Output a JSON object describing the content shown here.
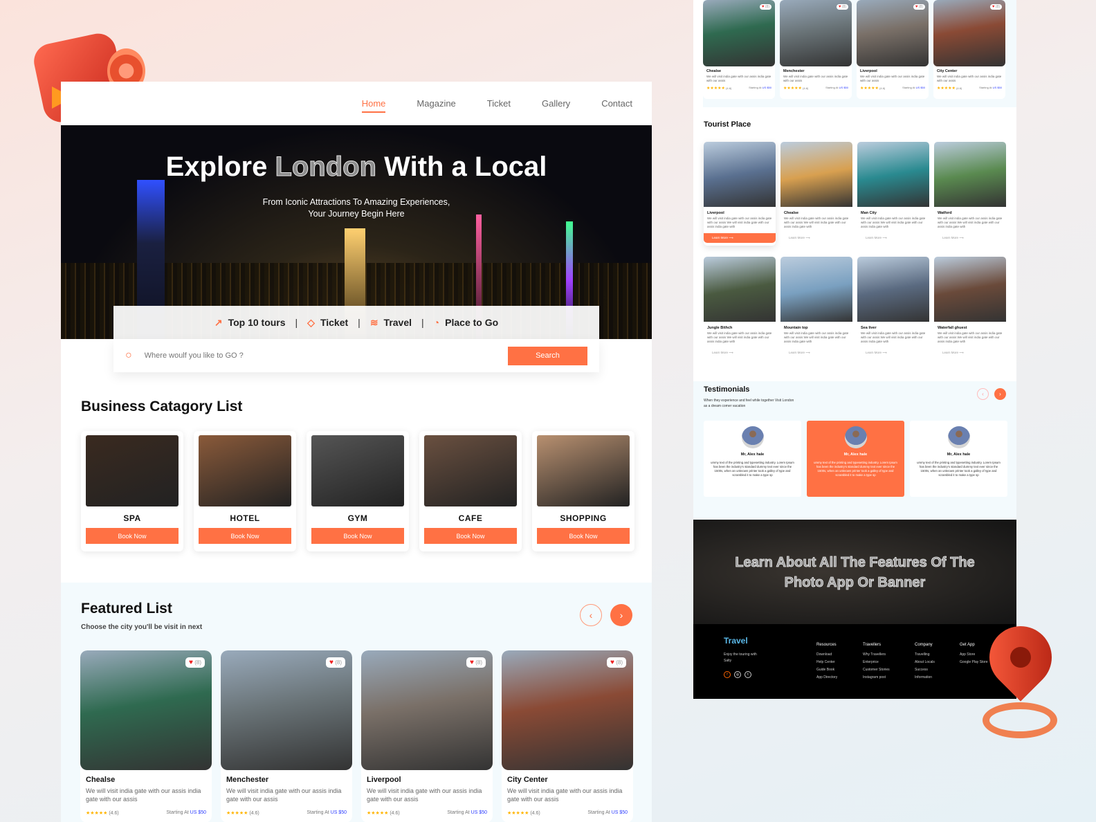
{
  "nav": {
    "items": [
      "Home",
      "Magazine",
      "Ticket",
      "Gallery",
      "Contact"
    ],
    "active": 0
  },
  "hero": {
    "title_pre": "Explore",
    "title_mid": "London",
    "title_post": "With a Local",
    "subtitle_1": "From Iconic Attractions To Amazing Experiences,",
    "subtitle_2": "Your Journey Begin Here"
  },
  "tabs": [
    {
      "icon": "trending-up-icon",
      "glyph": "↗",
      "label": "Top 10 tours"
    },
    {
      "icon": "ticket-icon",
      "glyph": "◇",
      "label": "Ticket"
    },
    {
      "icon": "travel-icon",
      "glyph": "≋",
      "label": "Travel"
    },
    {
      "icon": "location-icon",
      "glyph": "◔",
      "label": "Place to Go"
    }
  ],
  "search": {
    "placeholder": "Where woulf you like to GO ?",
    "button": "Search"
  },
  "business": {
    "title": "Business Catagory List",
    "button": "Book Now",
    "items": [
      {
        "name": "SPA",
        "color": "#3a2a20"
      },
      {
        "name": "HOTEL",
        "color": "#8a5a3a"
      },
      {
        "name": "GYM",
        "color": "#555"
      },
      {
        "name": "CAFE",
        "color": "#6a5040"
      },
      {
        "name": "SHOPPING",
        "color": "#b89070"
      }
    ]
  },
  "featured": {
    "title": "Featured List",
    "subtitle": "Choose the city you'll be visit in next",
    "items": [
      {
        "title": "Chealse",
        "desc": "We will visit india gate with our assis india gate with our assis",
        "likes": "(8)",
        "rating": "(4.6)",
        "price_label": "Starting At",
        "price": "US $50",
        "color": "#2f6a50"
      },
      {
        "title": "Menchester",
        "desc": "We will visit india gate with our assis india gate with our assis",
        "likes": "(8)",
        "rating": "(4.6)",
        "price_label": "Starting At",
        "price": "US $50",
        "color": "#6a7478"
      },
      {
        "title": "Liverpool",
        "desc": "We will visit india gate with our assis india gate with our assis",
        "likes": "(8)",
        "rating": "(4.6)",
        "price_label": "Starting At",
        "price": "US $50",
        "color": "#7a7068"
      },
      {
        "title": "City Center",
        "desc": "We will visit india gate with our assis india gate with our assis",
        "likes": "(8)",
        "rating": "(4.6)",
        "price_label": "Starting At",
        "price": "US $50",
        "color": "#8a4a35"
      }
    ]
  },
  "tourist": {
    "title": "Tourist Place",
    "learn_more": "Learn More",
    "desc": "We will visit india gate with our assis india gate with our assis We will visit india gate with our assis india gate with",
    "items": [
      {
        "title": "Liverpool",
        "color": "#5a7090"
      },
      {
        "title": "Chealse",
        "color": "#d8a050"
      },
      {
        "title": "Man City",
        "color": "#2a8a90"
      },
      {
        "title": "Watford",
        "color": "#5a8a50"
      },
      {
        "title": "Jungle Bithch",
        "color": "#4a5a40"
      },
      {
        "title": "Mountain top",
        "color": "#7aa0c0"
      },
      {
        "title": "Sea liver",
        "color": "#5a6a80"
      },
      {
        "title": "Waterfall ghuest",
        "color": "#6a4a3a"
      }
    ]
  },
  "testimonials": {
    "title": "Testimonials",
    "subtitle_1": "When they experience and feel while together  Visit London",
    "subtitle_2": "as a dream comer vacation",
    "items": [
      {
        "name": "Mr, Alex hale",
        "quote": "ummy text of the printing and typesetting industry. Lorem Ipsum has been the industry's standard dummy text ever since the 1500s, when an unknown printer took a galley of type and scrambled it to make a type sp"
      },
      {
        "name": "Mr, Alex hale",
        "quote": "ummy text of the printing and typesetting industry. Lorem Ipsum has been the industry's standard dummy text ever since the 1500s, when an unknown printer took a galley of type and scrambled it to make a type sp"
      },
      {
        "name": "Mr, Alex hale",
        "quote": "ummy text of the printing and typesetting industry. Lorem Ipsum has been the industry's standard dummy text ever since the 1500s, when an unknown printer took a galley of type and scrambled it to make a type sp"
      }
    ]
  },
  "banner": {
    "line1": "Learn About All The Features Of The",
    "line2": "Photo App Or Banner"
  },
  "footer": {
    "logo": "Travel",
    "tagline": "Enjoy the touring with Salty",
    "social": [
      "f",
      "◎",
      "t"
    ],
    "columns": [
      {
        "heading": "Resources",
        "links": [
          "Download",
          "Help Center",
          "Guide Book",
          "App Directory"
        ]
      },
      {
        "heading": "Travellers",
        "links": [
          "Why Travellers",
          "Enterprice",
          "Customer Stories",
          "Instagram post"
        ]
      },
      {
        "heading": "Company",
        "links": [
          "Travelling",
          "About Locals",
          "Success",
          "Information"
        ]
      },
      {
        "heading": "Get App",
        "links": [
          "App Store",
          "Google Play Store"
        ]
      }
    ]
  },
  "colors": {
    "accent": "#ff7144",
    "price": "#2a3bff"
  }
}
